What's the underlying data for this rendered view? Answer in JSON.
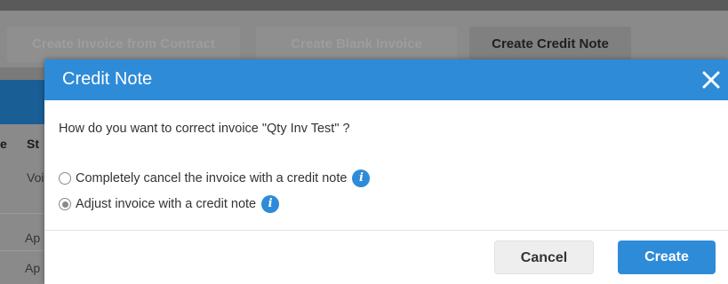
{
  "toolbar": {
    "create_from_contract": "Create Invoice from Contract",
    "create_blank": "Create Blank Invoice",
    "create_credit_note": "Create Credit Note"
  },
  "table": {
    "header_partial_1": "e",
    "header_partial_2": "St",
    "rows": [
      "Voi",
      "Ap",
      "Ap"
    ]
  },
  "modal": {
    "title": "Credit Note",
    "question": "How do you want to correct invoice \"Qty Inv Test\" ?",
    "options": [
      {
        "label": "Completely cancel the invoice with a credit note",
        "selected": false
      },
      {
        "label": "Adjust invoice with a credit note",
        "selected": true
      }
    ],
    "cancel_label": "Cancel",
    "create_label": "Create"
  },
  "colors": {
    "accent": "#2e8bd8",
    "overlay": "#7a7a7a"
  },
  "icons": {
    "close": "close-icon",
    "info": "info-icon"
  }
}
